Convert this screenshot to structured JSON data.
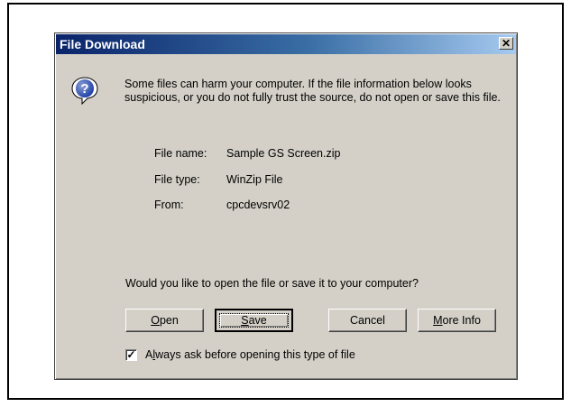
{
  "dialog": {
    "title": "File Download",
    "message": "Some files can harm your computer. If the file information below looks suspicious, or you do not fully trust the source, do not open or save this file.",
    "file_info": [
      {
        "label": "File name:",
        "value": "Sample GS Screen.zip"
      },
      {
        "label": "File type:",
        "value": "WinZip File"
      },
      {
        "label": "From:",
        "value": "cpcdevsrv02"
      }
    ],
    "question": "Would you like to open the file or save it to your computer?",
    "buttons": {
      "open": "Open",
      "save": "Save",
      "cancel": "Cancel",
      "more_info": "More Info"
    },
    "checkbox": {
      "label": "Always ask before opening this type of file",
      "checked": true
    }
  },
  "icons": {
    "close": "close-icon",
    "question": "question-icon"
  }
}
